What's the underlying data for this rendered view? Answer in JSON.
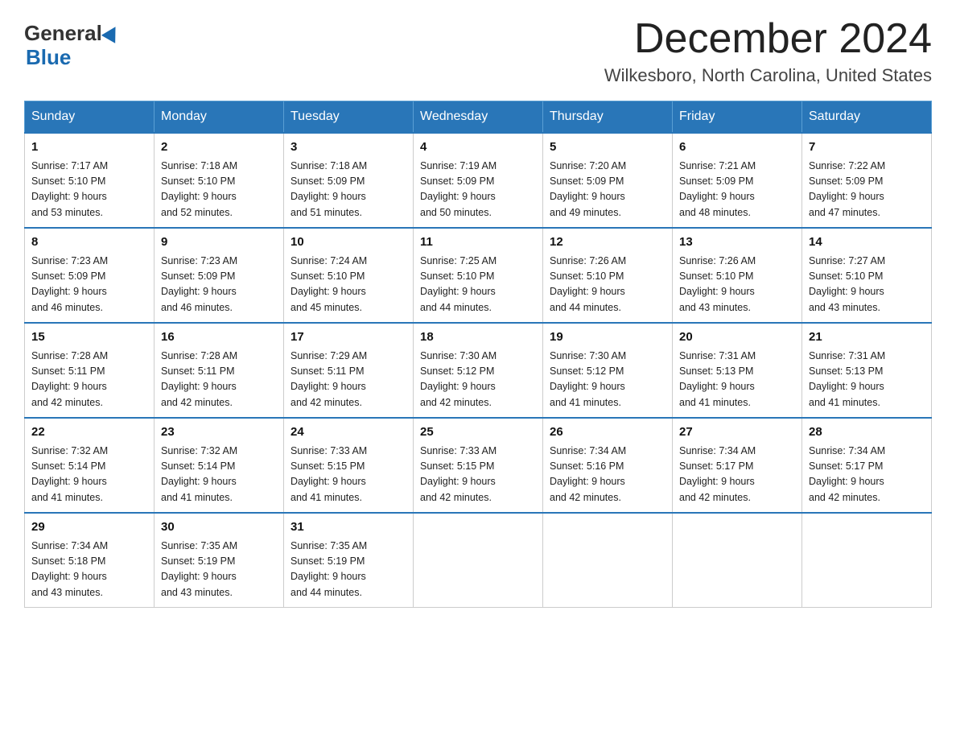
{
  "header": {
    "logo_general": "General",
    "logo_blue": "Blue",
    "month": "December 2024",
    "location": "Wilkesboro, North Carolina, United States"
  },
  "weekdays": [
    "Sunday",
    "Monday",
    "Tuesday",
    "Wednesday",
    "Thursday",
    "Friday",
    "Saturday"
  ],
  "weeks": [
    [
      {
        "day": "1",
        "sunrise": "7:17 AM",
        "sunset": "5:10 PM",
        "daylight": "9 hours and 53 minutes."
      },
      {
        "day": "2",
        "sunrise": "7:18 AM",
        "sunset": "5:10 PM",
        "daylight": "9 hours and 52 minutes."
      },
      {
        "day": "3",
        "sunrise": "7:18 AM",
        "sunset": "5:09 PM",
        "daylight": "9 hours and 51 minutes."
      },
      {
        "day": "4",
        "sunrise": "7:19 AM",
        "sunset": "5:09 PM",
        "daylight": "9 hours and 50 minutes."
      },
      {
        "day": "5",
        "sunrise": "7:20 AM",
        "sunset": "5:09 PM",
        "daylight": "9 hours and 49 minutes."
      },
      {
        "day": "6",
        "sunrise": "7:21 AM",
        "sunset": "5:09 PM",
        "daylight": "9 hours and 48 minutes."
      },
      {
        "day": "7",
        "sunrise": "7:22 AM",
        "sunset": "5:09 PM",
        "daylight": "9 hours and 47 minutes."
      }
    ],
    [
      {
        "day": "8",
        "sunrise": "7:23 AM",
        "sunset": "5:09 PM",
        "daylight": "9 hours and 46 minutes."
      },
      {
        "day": "9",
        "sunrise": "7:23 AM",
        "sunset": "5:09 PM",
        "daylight": "9 hours and 46 minutes."
      },
      {
        "day": "10",
        "sunrise": "7:24 AM",
        "sunset": "5:10 PM",
        "daylight": "9 hours and 45 minutes."
      },
      {
        "day": "11",
        "sunrise": "7:25 AM",
        "sunset": "5:10 PM",
        "daylight": "9 hours and 44 minutes."
      },
      {
        "day": "12",
        "sunrise": "7:26 AM",
        "sunset": "5:10 PM",
        "daylight": "9 hours and 44 minutes."
      },
      {
        "day": "13",
        "sunrise": "7:26 AM",
        "sunset": "5:10 PM",
        "daylight": "9 hours and 43 minutes."
      },
      {
        "day": "14",
        "sunrise": "7:27 AM",
        "sunset": "5:10 PM",
        "daylight": "9 hours and 43 minutes."
      }
    ],
    [
      {
        "day": "15",
        "sunrise": "7:28 AM",
        "sunset": "5:11 PM",
        "daylight": "9 hours and 42 minutes."
      },
      {
        "day": "16",
        "sunrise": "7:28 AM",
        "sunset": "5:11 PM",
        "daylight": "9 hours and 42 minutes."
      },
      {
        "day": "17",
        "sunrise": "7:29 AM",
        "sunset": "5:11 PM",
        "daylight": "9 hours and 42 minutes."
      },
      {
        "day": "18",
        "sunrise": "7:30 AM",
        "sunset": "5:12 PM",
        "daylight": "9 hours and 42 minutes."
      },
      {
        "day": "19",
        "sunrise": "7:30 AM",
        "sunset": "5:12 PM",
        "daylight": "9 hours and 41 minutes."
      },
      {
        "day": "20",
        "sunrise": "7:31 AM",
        "sunset": "5:13 PM",
        "daylight": "9 hours and 41 minutes."
      },
      {
        "day": "21",
        "sunrise": "7:31 AM",
        "sunset": "5:13 PM",
        "daylight": "9 hours and 41 minutes."
      }
    ],
    [
      {
        "day": "22",
        "sunrise": "7:32 AM",
        "sunset": "5:14 PM",
        "daylight": "9 hours and 41 minutes."
      },
      {
        "day": "23",
        "sunrise": "7:32 AM",
        "sunset": "5:14 PM",
        "daylight": "9 hours and 41 minutes."
      },
      {
        "day": "24",
        "sunrise": "7:33 AM",
        "sunset": "5:15 PM",
        "daylight": "9 hours and 41 minutes."
      },
      {
        "day": "25",
        "sunrise": "7:33 AM",
        "sunset": "5:15 PM",
        "daylight": "9 hours and 42 minutes."
      },
      {
        "day": "26",
        "sunrise": "7:34 AM",
        "sunset": "5:16 PM",
        "daylight": "9 hours and 42 minutes."
      },
      {
        "day": "27",
        "sunrise": "7:34 AM",
        "sunset": "5:17 PM",
        "daylight": "9 hours and 42 minutes."
      },
      {
        "day": "28",
        "sunrise": "7:34 AM",
        "sunset": "5:17 PM",
        "daylight": "9 hours and 42 minutes."
      }
    ],
    [
      {
        "day": "29",
        "sunrise": "7:34 AM",
        "sunset": "5:18 PM",
        "daylight": "9 hours and 43 minutes."
      },
      {
        "day": "30",
        "sunrise": "7:35 AM",
        "sunset": "5:19 PM",
        "daylight": "9 hours and 43 minutes."
      },
      {
        "day": "31",
        "sunrise": "7:35 AM",
        "sunset": "5:19 PM",
        "daylight": "9 hours and 44 minutes."
      },
      null,
      null,
      null,
      null
    ]
  ],
  "labels": {
    "sunrise_prefix": "Sunrise: ",
    "sunset_prefix": "Sunset: ",
    "daylight_prefix": "Daylight: "
  }
}
